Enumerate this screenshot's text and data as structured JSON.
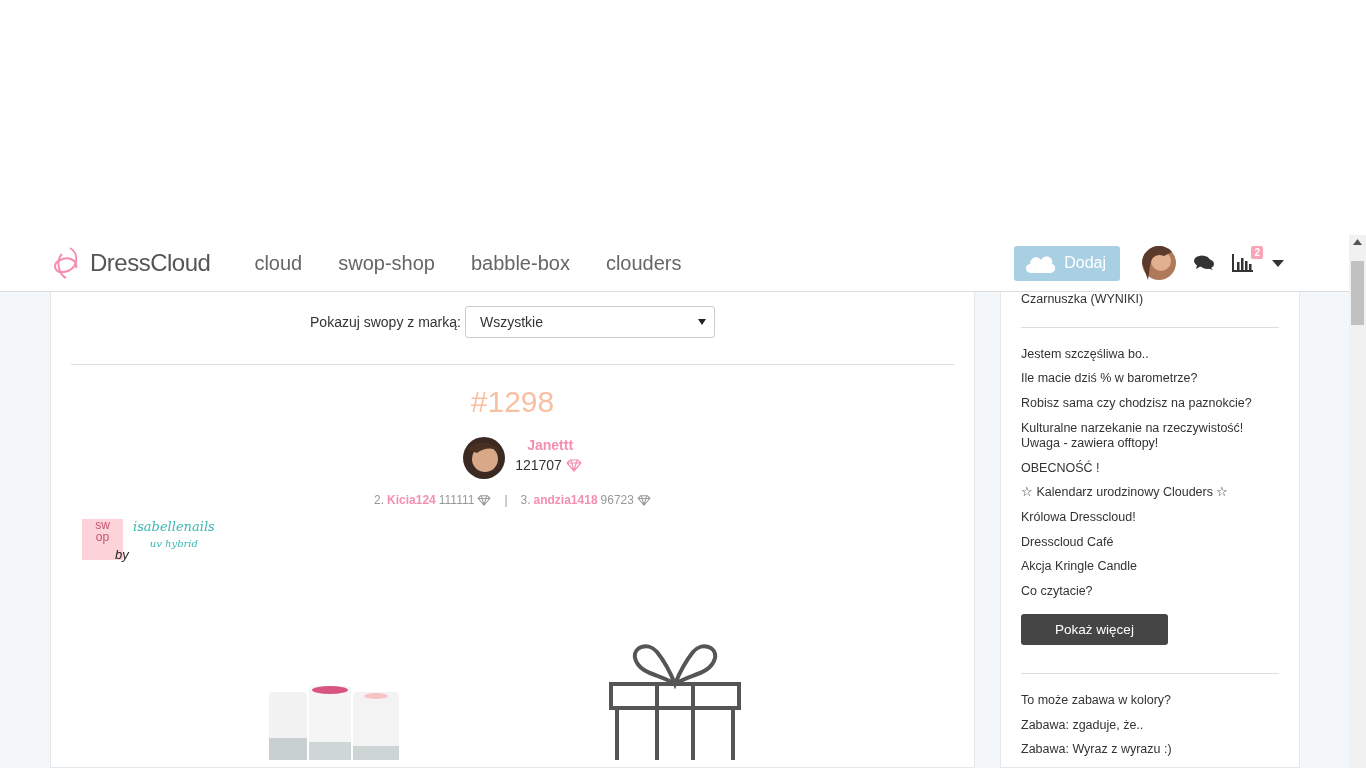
{
  "header": {
    "logo": "DressCloud",
    "nav": [
      {
        "label": "cloud"
      },
      {
        "label": "swop-shop"
      },
      {
        "label": "babble-box"
      },
      {
        "label": "clouders"
      }
    ],
    "add_button": "Dodaj",
    "stats_badge": "2"
  },
  "filter": {
    "label": "Pokazuj swopy z marką:",
    "value": "Wszystkie"
  },
  "swop": {
    "number": "#1298",
    "winner": {
      "name": "Janettt",
      "points": "121707"
    },
    "others": [
      {
        "rank": "2.",
        "name": "Kicia124",
        "points": "111111"
      },
      {
        "rank": "3.",
        "name": "andzia1418",
        "points": "96723"
      }
    ],
    "separator": "|",
    "brand": {
      "swop_top": "sw",
      "swop_bottom": "op",
      "by": "by",
      "name": "isabellenails",
      "sub": "uv hybrid"
    }
  },
  "sidebar": {
    "top_item": "Czarnuszka (WYNIKI)",
    "topics": [
      "Jestem szczęśliwa bo..",
      "Ile macie dziś % w barometrze?",
      "Robisz sama czy chodzisz na paznokcie?",
      "Kulturalne narzekanie na rzeczywistość! Uwaga - zawiera offtopy!",
      "OBECNOŚĆ !",
      "☆ Kalendarz urodzinowy Clouders ☆",
      "Królowa Dresscloud!",
      "Dresscloud Café",
      "Akcja Kringle Candle",
      "Co czytacie?"
    ],
    "more_button": "Pokaż więcej",
    "games": [
      "To może zabawa w kolory?",
      "Zabawa: zgaduje, że..",
      "Zabawa: Wyraz z wyrazu :)"
    ]
  }
}
